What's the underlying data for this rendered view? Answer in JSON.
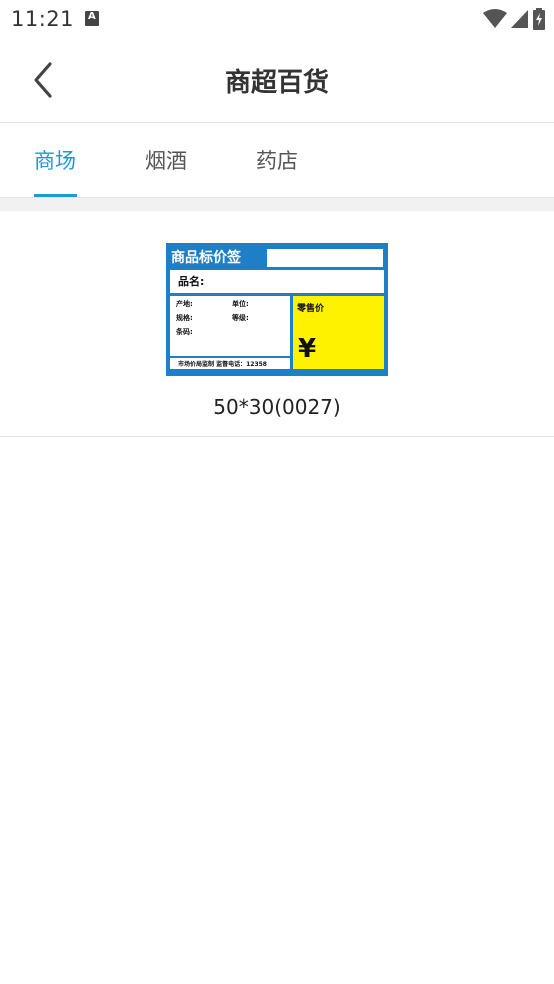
{
  "status_bar": {
    "time": "11:21",
    "notification_icon": "a-icon",
    "icons": [
      "wifi-icon",
      "signal-icon",
      "battery-charging-icon"
    ]
  },
  "app_bar": {
    "back_icon": "chevron-left-icon",
    "title": "商超百货"
  },
  "tabs": [
    {
      "label": "商场",
      "active": true
    },
    {
      "label": "烟酒",
      "active": false
    },
    {
      "label": "药店",
      "active": false
    }
  ],
  "accent_color": "#1a9bd7",
  "templates": [
    {
      "caption": "50*30(0027)",
      "preview": {
        "header": "商品标价签",
        "name_label": "品名:",
        "origin_label": "产地:",
        "unit_label": "单位:",
        "spec_label": "规格:",
        "grade_label": "等级:",
        "barcode_label": "条码:",
        "retail_price_label": "零售价",
        "currency_symbol": "¥",
        "footer_text": "市场价局监制  监督电话：12358",
        "frame_color": "#1f7fc6",
        "price_color": "#fff200"
      }
    }
  ]
}
